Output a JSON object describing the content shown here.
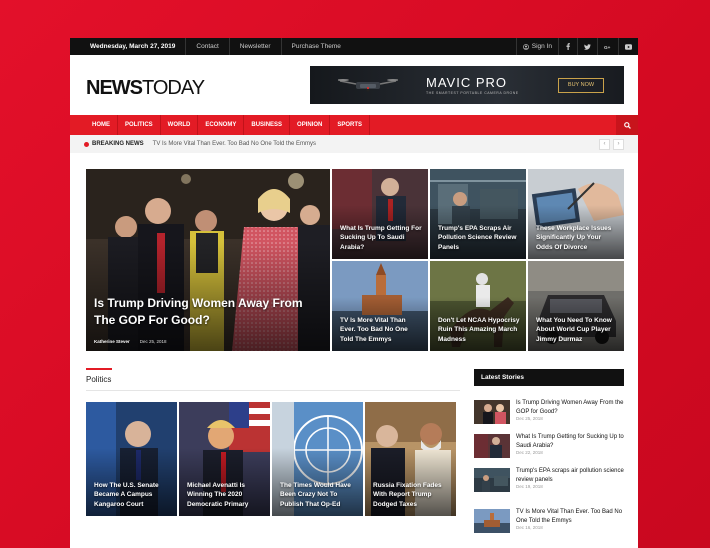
{
  "topbar": {
    "date": "Wednesday, March 27, 2019",
    "links": [
      "Contact",
      "Newsletter",
      "Purchase Theme"
    ],
    "signin": "Sign In",
    "social_icons": [
      "facebook-icon",
      "twitter-icon",
      "googleplus-icon",
      "youtube-icon"
    ]
  },
  "header": {
    "logo_bold": "NEWS",
    "logo_light": "TODAY",
    "ad": {
      "brand": "MAVIC PRO",
      "tagline": "THE SMARTEST PORTABLE CAMERA DRONE",
      "cta": "BUY NOW"
    }
  },
  "nav": {
    "items": [
      "HOME",
      "POLITICS",
      "WORLD",
      "ECONOMY",
      "BUSINESS",
      "OPINION",
      "SPORTS"
    ]
  },
  "breaking": {
    "label": "BREAKING NEWS",
    "text": "TV Is More Vital Than Ever. Too Bad No One Told the Emmys"
  },
  "featured": {
    "title": "Is Trump Driving Women Away From The GOP For Good?",
    "author": "Katherine Stever",
    "date": "Dec 25, 2018"
  },
  "tiles": [
    {
      "title": "What Is Trump Getting For Sucking Up To Saudi Arabia?"
    },
    {
      "title": "Trump's EPA Scraps Air Pollution Science Review Panels"
    },
    {
      "title": "These Workplace Issues Significantly Up Your Odds Of Divorce"
    },
    {
      "title": "TV Is More Vital Than Ever. Too Bad No One Told The Emmys"
    },
    {
      "title": "Don't Let NCAA Hypocrisy Ruin This Amazing March Madness"
    },
    {
      "title": "What You Need To Know About World Cup Player Jimmy Durmaz"
    }
  ],
  "politics": {
    "heading": "Politics",
    "cards": [
      {
        "title": "How The U.S. Senate Became A Campus Kangaroo Court"
      },
      {
        "title": "Michael Avenatti Is Winning The 2020 Democratic Primary"
      },
      {
        "title": "The Times Would Have Been Crazy Not To Publish That Op-Ed"
      },
      {
        "title": "Russia Fixation Fades With Report Trump Dodged Taxes"
      }
    ]
  },
  "latest": {
    "heading": "Latest Stories",
    "items": [
      {
        "title": "Is Trump Driving Women Away From the GOP for Good?",
        "date": "Dec 25, 2018"
      },
      {
        "title": "What Is Trump Getting for Sucking Up to Saudi Arabia?",
        "date": "Dec 22, 2018"
      },
      {
        "title": "Trump's EPA scraps air pollution science review panels",
        "date": "Dec 19, 2018"
      },
      {
        "title": "TV Is More Vital Than Ever. Too Bad No One Told the Emmys",
        "date": "Dec 16, 2018"
      }
    ]
  },
  "colors": {
    "accent": "#e31b25",
    "dark": "#111111",
    "background": "#e3102a"
  }
}
